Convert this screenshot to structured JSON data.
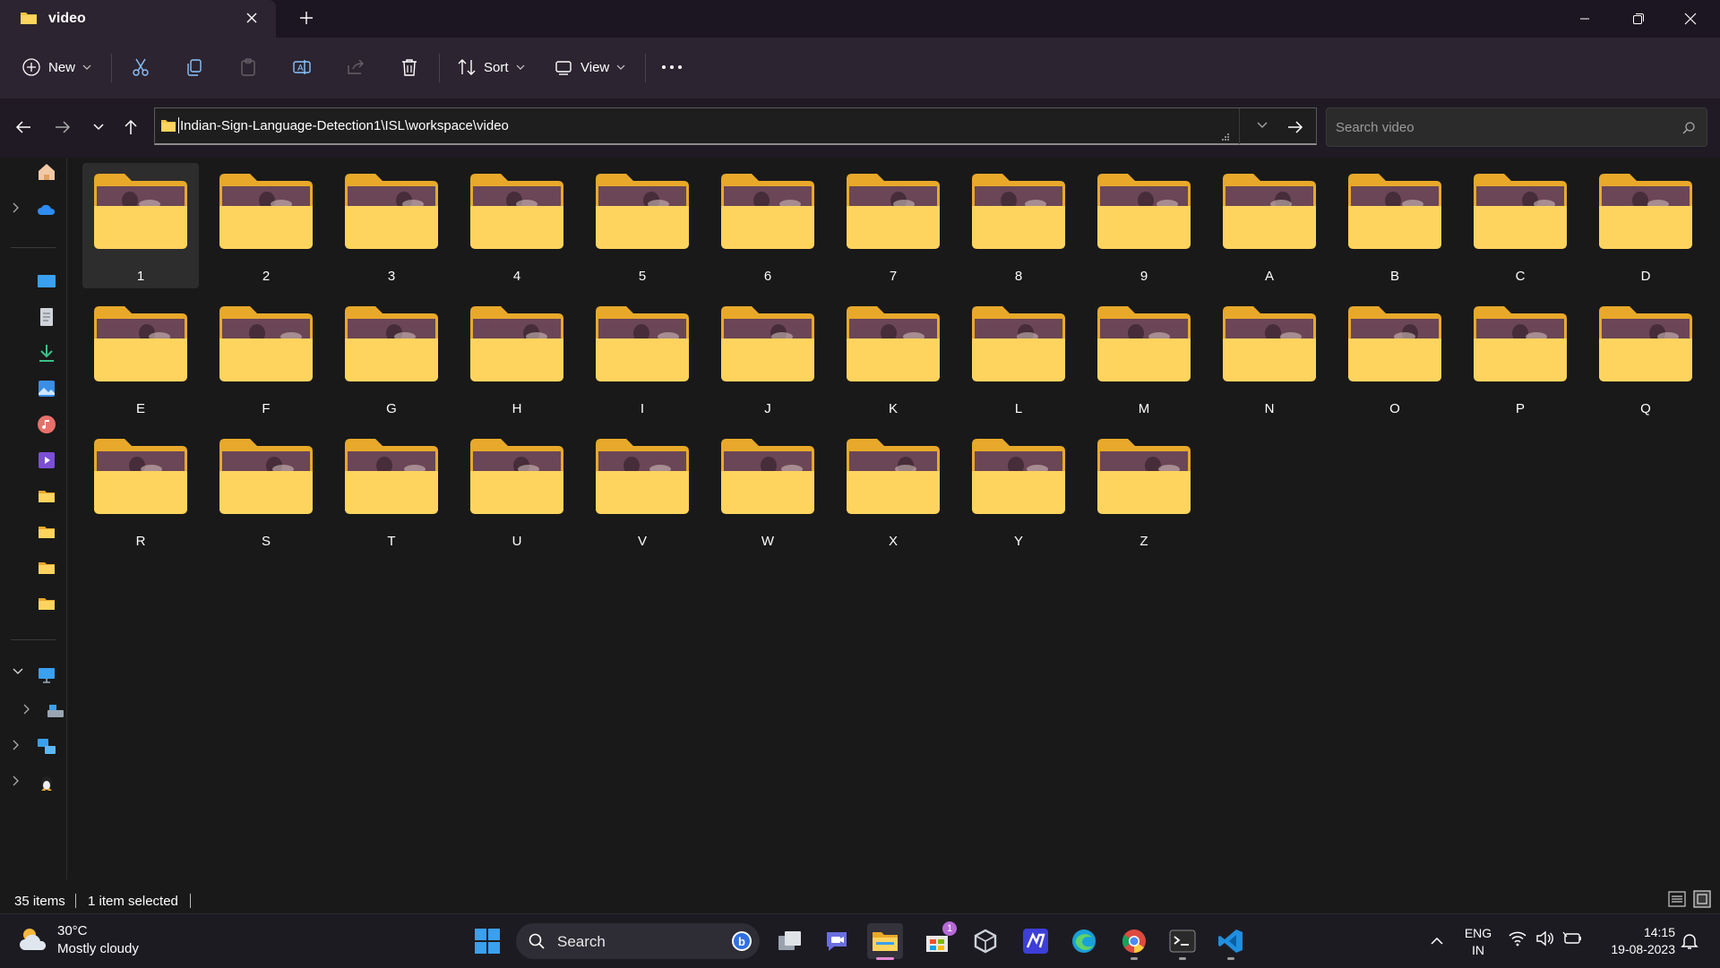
{
  "window": {
    "tab_title": "video",
    "controls": {
      "minimize": "minimize-icon",
      "maximize": "restore-icon",
      "close": "close-icon"
    }
  },
  "toolbar": {
    "new_label": "New",
    "sort_label": "Sort",
    "view_label": "View",
    "icons": [
      "cut-icon",
      "copy-icon",
      "paste-icon",
      "rename-icon",
      "share-icon",
      "delete-icon",
      "more-icon"
    ]
  },
  "address": {
    "path": "Indian-Sign-Language-Detection1\\ISL\\workspace\\video",
    "search_placeholder": "Search video"
  },
  "folders": [
    {
      "name": "1"
    },
    {
      "name": "2"
    },
    {
      "name": "3"
    },
    {
      "name": "4"
    },
    {
      "name": "5"
    },
    {
      "name": "6"
    },
    {
      "name": "7"
    },
    {
      "name": "8"
    },
    {
      "name": "9"
    },
    {
      "name": "A"
    },
    {
      "name": "B"
    },
    {
      "name": "C"
    },
    {
      "name": "D"
    },
    {
      "name": "E"
    },
    {
      "name": "F"
    },
    {
      "name": "G"
    },
    {
      "name": "H"
    },
    {
      "name": "I"
    },
    {
      "name": "J"
    },
    {
      "name": "K"
    },
    {
      "name": "L"
    },
    {
      "name": "M"
    },
    {
      "name": "N"
    },
    {
      "name": "O"
    },
    {
      "name": "P"
    },
    {
      "name": "Q"
    },
    {
      "name": "R"
    },
    {
      "name": "S"
    },
    {
      "name": "T"
    },
    {
      "name": "U"
    },
    {
      "name": "V"
    },
    {
      "name": "W"
    },
    {
      "name": "X"
    },
    {
      "name": "Y"
    },
    {
      "name": "Z"
    }
  ],
  "selected_folder": "1",
  "status": {
    "item_count": "35 items",
    "selection": "1 item selected"
  },
  "taskbar": {
    "weather_temp": "30°C",
    "weather_desc": "Mostly cloudy",
    "search_label": "Search",
    "store_badge": "1",
    "lang_line1": "ENG",
    "lang_line2": "IN",
    "time": "14:15",
    "date": "19-08-2023"
  },
  "colors": {
    "folder_back": "#e8a92a",
    "folder_front": "#ffd45e",
    "thumbnail": "#6b4656",
    "accent": "#4cc2ff"
  }
}
